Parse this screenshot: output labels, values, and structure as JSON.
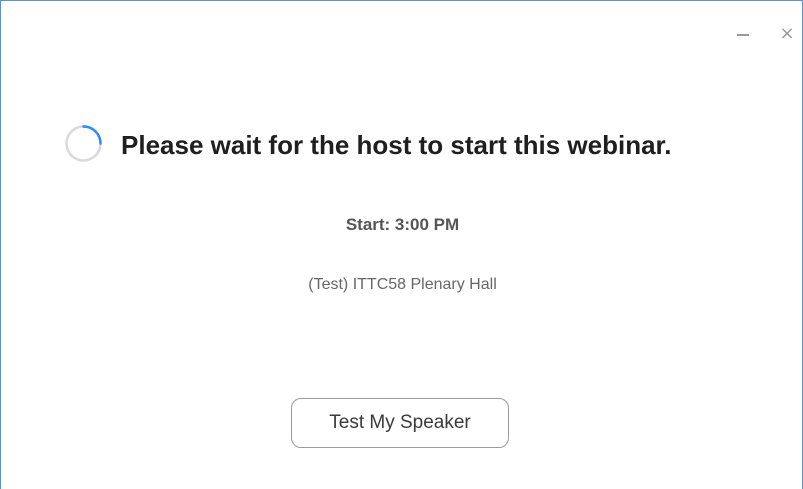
{
  "window": {
    "minimize_icon": "minimize-icon",
    "close_icon": "close-icon",
    "close_glyph": "×"
  },
  "status": {
    "spinner_icon": "loading-spinner-icon",
    "spinner_track_color": "#d9d9d9",
    "spinner_accent_color": "#2d8cff",
    "headline": "Please wait for the host to start this webinar.",
    "start_time": "Start: 3:00 PM",
    "event_name": "(Test) ITTC58 Plenary Hall"
  },
  "actions": {
    "test_speaker_label": "Test My Speaker"
  }
}
